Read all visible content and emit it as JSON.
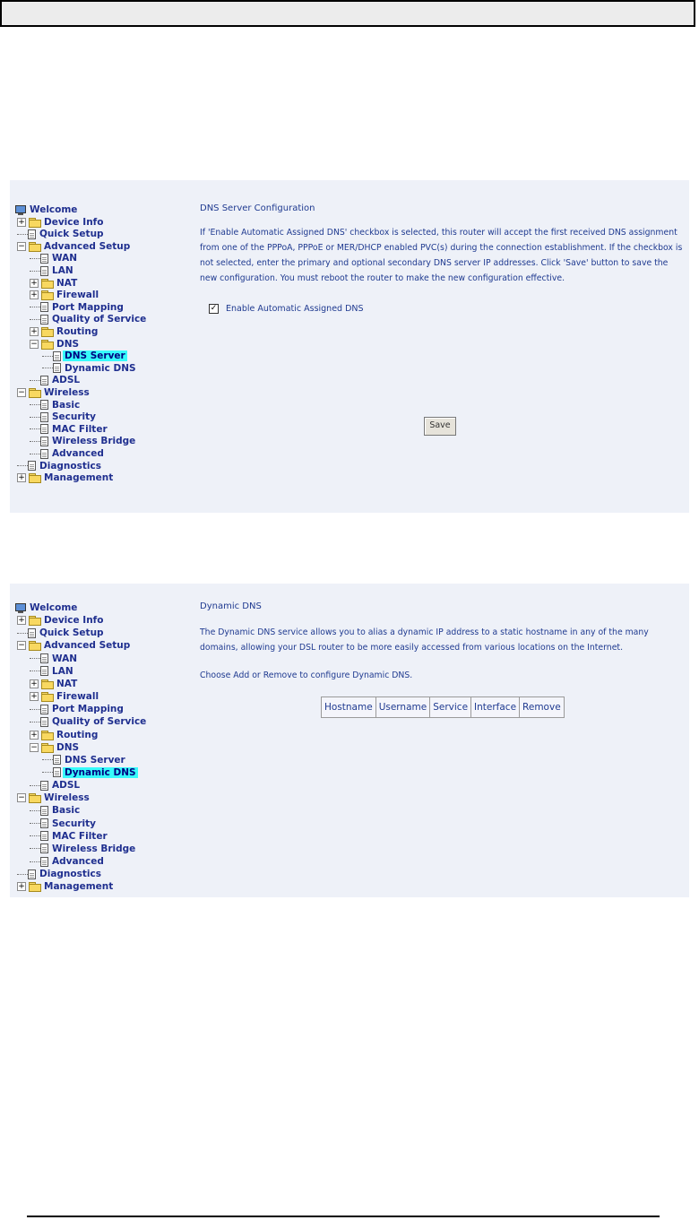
{
  "screens": [
    {
      "tree": [
        {
          "label": "Welcome",
          "depth": 0,
          "icon": "monitor-icon"
        },
        {
          "label": "Device Info",
          "depth": 1,
          "icon": "folder-icon",
          "expander": "+"
        },
        {
          "label": "Quick Setup",
          "depth": 1,
          "icon": "page-icon"
        },
        {
          "label": "Advanced Setup",
          "depth": 1,
          "icon": "folder-open-icon",
          "expander": "-"
        },
        {
          "label": "WAN",
          "depth": 2,
          "icon": "page-icon"
        },
        {
          "label": "LAN",
          "depth": 2,
          "icon": "page-icon"
        },
        {
          "label": "NAT",
          "depth": 2,
          "icon": "folder-icon",
          "expander": "+"
        },
        {
          "label": "Firewall",
          "depth": 2,
          "icon": "folder-icon",
          "expander": "+"
        },
        {
          "label": "Port Mapping",
          "depth": 2,
          "icon": "page-icon"
        },
        {
          "label": "Quality of Service",
          "depth": 2,
          "icon": "page-icon"
        },
        {
          "label": "Routing",
          "depth": 2,
          "icon": "folder-icon",
          "expander": "+"
        },
        {
          "label": "DNS",
          "depth": 2,
          "icon": "folder-open-icon",
          "expander": "-"
        },
        {
          "label": "DNS Server",
          "depth": 3,
          "icon": "page-icon",
          "selected": true
        },
        {
          "label": "Dynamic DNS",
          "depth": 3,
          "icon": "page-icon"
        },
        {
          "label": "ADSL",
          "depth": 2,
          "icon": "page-icon"
        },
        {
          "label": "Wireless",
          "depth": 1,
          "icon": "folder-open-icon",
          "expander": "-"
        },
        {
          "label": "Basic",
          "depth": 2,
          "icon": "page-icon"
        },
        {
          "label": "Security",
          "depth": 2,
          "icon": "page-icon"
        },
        {
          "label": "MAC Filter",
          "depth": 2,
          "icon": "page-icon"
        },
        {
          "label": "Wireless Bridge",
          "depth": 2,
          "icon": "page-icon"
        },
        {
          "label": "Advanced",
          "depth": 2,
          "icon": "page-icon"
        },
        {
          "label": "Diagnostics",
          "depth": 1,
          "icon": "page-icon"
        },
        {
          "label": "Management",
          "depth": 1,
          "icon": "folder-icon",
          "expander": "+"
        }
      ]
    },
    {
      "tree": [
        {
          "label": "Welcome",
          "depth": 0,
          "icon": "monitor-icon"
        },
        {
          "label": "Device Info",
          "depth": 1,
          "icon": "folder-icon",
          "expander": "+"
        },
        {
          "label": "Quick Setup",
          "depth": 1,
          "icon": "page-icon"
        },
        {
          "label": "Advanced Setup",
          "depth": 1,
          "icon": "folder-open-icon",
          "expander": "-"
        },
        {
          "label": "WAN",
          "depth": 2,
          "icon": "page-icon"
        },
        {
          "label": "LAN",
          "depth": 2,
          "icon": "page-icon"
        },
        {
          "label": "NAT",
          "depth": 2,
          "icon": "folder-icon",
          "expander": "+"
        },
        {
          "label": "Firewall",
          "depth": 2,
          "icon": "folder-icon",
          "expander": "+"
        },
        {
          "label": "Port Mapping",
          "depth": 2,
          "icon": "page-icon"
        },
        {
          "label": "Quality of Service",
          "depth": 2,
          "icon": "page-icon"
        },
        {
          "label": "Routing",
          "depth": 2,
          "icon": "folder-icon",
          "expander": "+"
        },
        {
          "label": "DNS",
          "depth": 2,
          "icon": "folder-open-icon",
          "expander": "-"
        },
        {
          "label": "DNS Server",
          "depth": 3,
          "icon": "page-icon"
        },
        {
          "label": "Dynamic DNS",
          "depth": 3,
          "icon": "page-icon",
          "selected": true
        },
        {
          "label": "ADSL",
          "depth": 2,
          "icon": "page-icon"
        },
        {
          "label": "Wireless",
          "depth": 1,
          "icon": "folder-open-icon",
          "expander": "-"
        },
        {
          "label": "Basic",
          "depth": 2,
          "icon": "page-icon"
        },
        {
          "label": "Security",
          "depth": 2,
          "icon": "page-icon"
        },
        {
          "label": "MAC Filter",
          "depth": 2,
          "icon": "page-icon"
        },
        {
          "label": "Wireless Bridge",
          "depth": 2,
          "icon": "page-icon"
        },
        {
          "label": "Advanced",
          "depth": 2,
          "icon": "page-icon"
        },
        {
          "label": "Diagnostics",
          "depth": 1,
          "icon": "page-icon"
        },
        {
          "label": "Management",
          "depth": 1,
          "icon": "folder-icon",
          "expander": "+"
        }
      ]
    }
  ],
  "dns_server": {
    "title": "DNS Server Configuration",
    "description": "If 'Enable Automatic Assigned DNS' checkbox is selected, this router will accept the first received DNS assignment from one of the PPPoA, PPPoE or MER/DHCP enabled PVC(s) during the connection establishment. If the checkbox is not selected, enter the primary and optional secondary DNS server IP addresses. Click 'Save' button to save the new configuration. You must reboot the router to make the new configuration effective.",
    "checkbox_label": "Enable Automatic Assigned DNS",
    "checkbox_checked": true,
    "save_label": "Save"
  },
  "dynamic_dns": {
    "title": "Dynamic DNS",
    "description": "The Dynamic DNS service allows you to alias a dynamic IP address to a static hostname in any of the many domains, allowing your DSL router to be more easily accessed from various locations on the Internet.",
    "instruction": "Choose Add or Remove to configure Dynamic DNS.",
    "table_headers": [
      "Hostname",
      "Username",
      "Service",
      "Interface",
      "Remove"
    ]
  },
  "colors": {
    "panel_bg": "#eef1f8",
    "link_text": "#1f2f8f",
    "selected_bg": "#37fbfb"
  }
}
